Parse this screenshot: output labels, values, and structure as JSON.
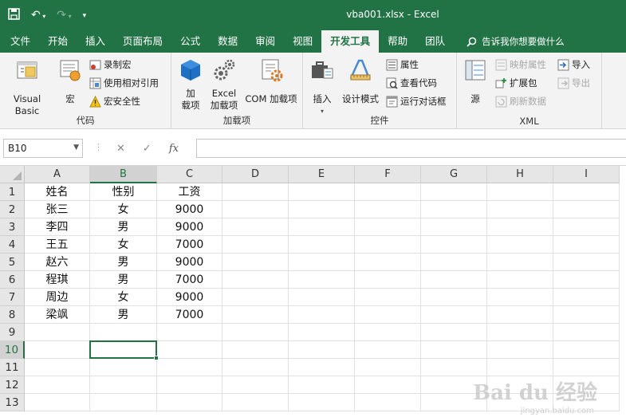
{
  "window": {
    "file_name": "vba001.xlsx",
    "separator": "-",
    "app_name": "Excel"
  },
  "tabs": [
    {
      "label": "文件",
      "active": false
    },
    {
      "label": "开始",
      "active": false
    },
    {
      "label": "插入",
      "active": false
    },
    {
      "label": "页面布局",
      "active": false
    },
    {
      "label": "公式",
      "active": false
    },
    {
      "label": "数据",
      "active": false
    },
    {
      "label": "审阅",
      "active": false
    },
    {
      "label": "视图",
      "active": false
    },
    {
      "label": "开发工具",
      "active": true
    },
    {
      "label": "帮助",
      "active": false
    },
    {
      "label": "团队",
      "active": false
    }
  ],
  "tell_me": "告诉我你想要做什么",
  "ribbon": {
    "code": {
      "label": "代码",
      "visual_basic": "Visual Basic",
      "macros": "宏",
      "record_macro": "录制宏",
      "relative_ref": "使用相对引用",
      "macro_security": "宏安全性"
    },
    "addins": {
      "label": "加载项",
      "addins_line1": "加",
      "addins_line2": "载项",
      "excel_addins_line1": "Excel",
      "excel_addins_line2": "加载项",
      "com_addins": "COM 加载项"
    },
    "controls": {
      "label": "控件",
      "insert": "插入",
      "design_mode": "设计模式",
      "properties": "属性",
      "view_code": "查看代码",
      "run_dialog": "运行对话框"
    },
    "xml": {
      "label": "XML",
      "source": "源",
      "map_properties": "映射属性",
      "expansion_packs": "扩展包",
      "refresh_data": "刷新数据",
      "import": "导入",
      "export": "导出"
    }
  },
  "formula_bar": {
    "name_box": "B10",
    "cancel": "✕",
    "enter": "✓",
    "fx": "fx",
    "formula": ""
  },
  "sheet": {
    "columns": [
      "A",
      "B",
      "C",
      "D",
      "E",
      "F",
      "G",
      "H",
      "I"
    ],
    "rows": [
      "1",
      "2",
      "3",
      "4",
      "5",
      "6",
      "7",
      "8",
      "9",
      "10",
      "11",
      "12",
      "13"
    ],
    "selected_cell": "B10",
    "cells": [
      [
        "姓名",
        "性别",
        "工资"
      ],
      [
        "张三",
        "女",
        "9000"
      ],
      [
        "李四",
        "男",
        "9000"
      ],
      [
        "王五",
        "女",
        "7000"
      ],
      [
        "赵六",
        "男",
        "9000"
      ],
      [
        "程琪",
        "男",
        "7000"
      ],
      [
        "周边",
        "女",
        "9000"
      ],
      [
        "梁飒",
        "男",
        "7000"
      ]
    ]
  },
  "watermark": {
    "brand": "Bai du 经验",
    "url": "jingyan.baidu.com"
  },
  "colors": {
    "accent": "#217346"
  }
}
